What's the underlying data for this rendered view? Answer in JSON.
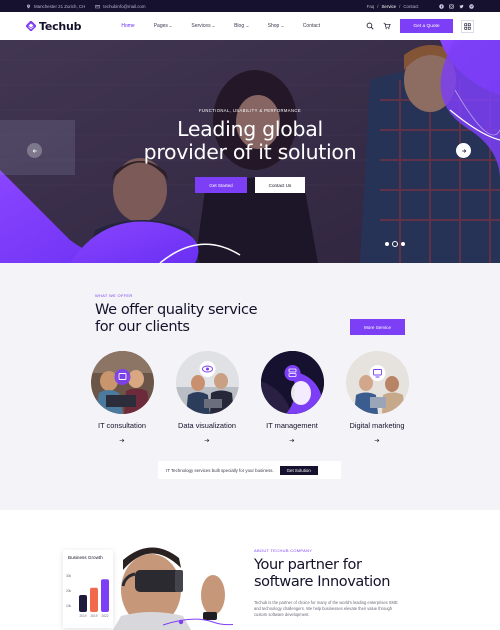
{
  "topbar": {
    "address": "Manchester 21 Zurich, CH",
    "email": "techubinfo@mail.com",
    "links": [
      "Faq",
      "Service",
      "Contact"
    ],
    "separator": "/",
    "active_link": "Service",
    "social_icons": [
      "facebook-icon",
      "instagram-icon",
      "twitter-icon",
      "pinterest-icon"
    ]
  },
  "header": {
    "logo": "Techub",
    "nav": [
      {
        "label": "Home",
        "active": true
      },
      {
        "label": "Pages",
        "dropdown": true
      },
      {
        "label": "Services",
        "dropdown": true
      },
      {
        "label": "Blog",
        "dropdown": true
      },
      {
        "label": "Shop",
        "dropdown": true
      },
      {
        "label": "Contact"
      }
    ],
    "quote_button": "Get a Quote"
  },
  "hero": {
    "eyebrow": "FUNCTIONAL, USABILITY & PERFORMANCE",
    "title_line1": "Leading global",
    "title_line2": "provider of it solution",
    "primary_button": "Get Started",
    "secondary_button": "Contact Us",
    "slide_count": 3,
    "active_slide": 2
  },
  "services": {
    "eyebrow": "WHAT WE OFFER",
    "title_line1": "We offer quality service",
    "title_line2": "for our clients",
    "more_button": "More Service",
    "items": [
      {
        "label": "IT consultation",
        "icon": "consulting-icon"
      },
      {
        "label": "Data visualization",
        "icon": "eye-icon"
      },
      {
        "label": "IT management",
        "icon": "server-icon"
      },
      {
        "label": "Digital marketing",
        "icon": "monitor-icon"
      }
    ],
    "strip_text": "IT Technology services built specially for your business.",
    "strip_button": "Get Solution"
  },
  "about": {
    "card_title": "Business Growth",
    "chart_data": {
      "type": "bar",
      "title": "Business Growth",
      "categories": [
        "2019",
        "2019",
        "2022"
      ],
      "values": [
        14,
        20,
        27
      ],
      "y_ticks": [
        "30k",
        "20k",
        "10k"
      ],
      "ylim": [
        0,
        33
      ],
      "colors": [
        "#1e1a3c",
        "#f26a4d",
        "#7d3ff5"
      ]
    },
    "eyebrow": "ABOUT TECHUB COMPANY",
    "title_line1": "Your partner for",
    "title_line2": "software Innovation",
    "text": "Techub is the partner of choice for many of the world's leading enterprises SME and technology challengers. We help businesses elevate their value through custom software development."
  },
  "colors": {
    "accent": "#7d3ff5",
    "dark": "#16112e",
    "orange": "#f26a4d"
  }
}
